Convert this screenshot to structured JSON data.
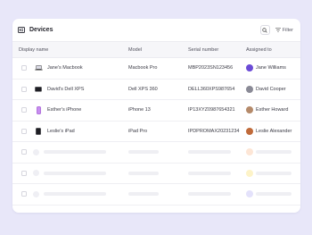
{
  "header": {
    "title": "Devices",
    "filter_label": "Filter"
  },
  "columns": {
    "name": "Display name",
    "model": "Model",
    "serial": "Serial number",
    "assigned": "Assigned to"
  },
  "rows": [
    {
      "name": "Jane's Macbook",
      "model": "Macbook Pro",
      "serial": "MBP2023SN123456",
      "assigned": "Jane Williams",
      "device_icon": "laptop-icon",
      "avatar_color": "#6b4bd6"
    },
    {
      "name": "David's Dell XPS",
      "model": "Dell XPS 360",
      "serial": "DELL360XPS987654",
      "assigned": "David Cooper",
      "device_icon": "laptop-dark-icon",
      "avatar_color": "#8a8a96"
    },
    {
      "name": "Esther's iPhone",
      "model": "iPhone 13",
      "serial": "IP13XYZ0987654321",
      "assigned": "Esther Howard",
      "device_icon": "phone-icon",
      "avatar_color": "#b58a6a"
    },
    {
      "name": "Leslie's iPad",
      "model": "iPad Pro",
      "serial": "IPDPROMAX20231234",
      "assigned": "Leslie Alexander",
      "device_icon": "tablet-icon",
      "avatar_color": "#c06a3a"
    }
  ],
  "skeleton_avatar_colors": [
    "#fde6d6",
    "#fdf3c8",
    "#e4e2fb"
  ],
  "colors": {
    "background": "#e8e7f9",
    "card": "#ffffff",
    "header_row": "#f6f6f9",
    "skeleton": "#efeff3"
  }
}
